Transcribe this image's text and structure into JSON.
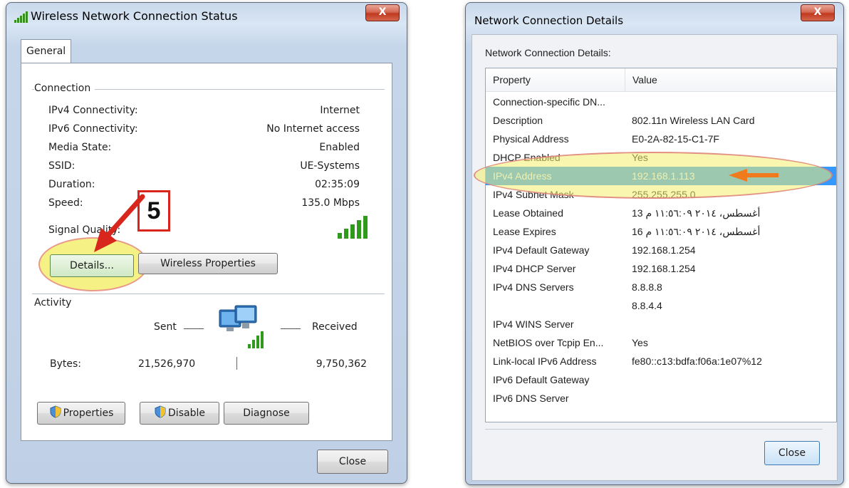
{
  "status_window": {
    "title": "Wireless Network Connection Status",
    "close_glyph": "X",
    "tab": "General",
    "connection": {
      "heading": "Connection",
      "rows": [
        {
          "label": "IPv4 Connectivity:",
          "value": "Internet"
        },
        {
          "label": "IPv6 Connectivity:",
          "value": "No Internet access"
        },
        {
          "label": "Media State:",
          "value": "Enabled"
        },
        {
          "label": "SSID:",
          "value": "UE-Systems"
        },
        {
          "label": "Duration:",
          "value": "02:35:09"
        },
        {
          "label": "Speed:",
          "value": "135.0 Mbps"
        }
      ],
      "signal_label": "Signal Quality:",
      "signal_bars": 5
    },
    "details_button": "Details...",
    "wireless_properties_button": "Wireless Properties",
    "activity": {
      "heading": "Activity",
      "sent_label": "Sent",
      "received_label": "Received",
      "bytes_label": "Bytes:",
      "bytes_sent": "21,526,970",
      "bytes_received": "9,750,362"
    },
    "properties_button": "Properties",
    "disable_button": "Disable",
    "diagnose_button": "Diagnose",
    "close_button": "Close"
  },
  "annotation": {
    "step_number": "5",
    "highlight_color": "#f3ef8a",
    "arrow_color": "#d9261c"
  },
  "details_window": {
    "title": "Network Connection Details",
    "close_glyph": "X",
    "section_label": "Network Connection Details:",
    "columns": {
      "property": "Property",
      "value": "Value"
    },
    "rows": [
      {
        "property": "Connection-specific DN...",
        "value": ""
      },
      {
        "property": "Description",
        "value": "802.11n Wireless LAN Card"
      },
      {
        "property": "Physical Address",
        "value": "E0-2A-82-15-C1-7F"
      },
      {
        "property": "DHCP Enabled",
        "value": "Yes"
      },
      {
        "property": "IPv4 Address",
        "value": "192.168.1.113",
        "selected": true
      },
      {
        "property": "IPv4 Subnet Mask",
        "value": "255.255.255.0"
      },
      {
        "property": "Lease Obtained",
        "value": "13 أغسطس، ٢٠١٤ ١١:٥٦:٠٩ م"
      },
      {
        "property": "Lease Expires",
        "value": "16 أغسطس، ٢٠١٤ ١١:٥٦:٠٩ م"
      },
      {
        "property": "IPv4 Default Gateway",
        "value": "192.168.1.254"
      },
      {
        "property": "IPv4 DHCP Server",
        "value": "192.168.1.254"
      },
      {
        "property": "IPv4 DNS Servers",
        "value": "8.8.8.8"
      },
      {
        "property": "",
        "value": "8.8.4.4"
      },
      {
        "property": "IPv4 WINS Server",
        "value": ""
      },
      {
        "property": "NetBIOS over Tcpip En...",
        "value": "Yes"
      },
      {
        "property": "Link-local IPv6 Address",
        "value": "fe80::c13:bdfa:f06a:1e07%12"
      },
      {
        "property": "IPv6 Default Gateway",
        "value": ""
      },
      {
        "property": "IPv6 DNS Server",
        "value": ""
      }
    ],
    "close_button": "Close",
    "selected_color": "#3399ff"
  }
}
